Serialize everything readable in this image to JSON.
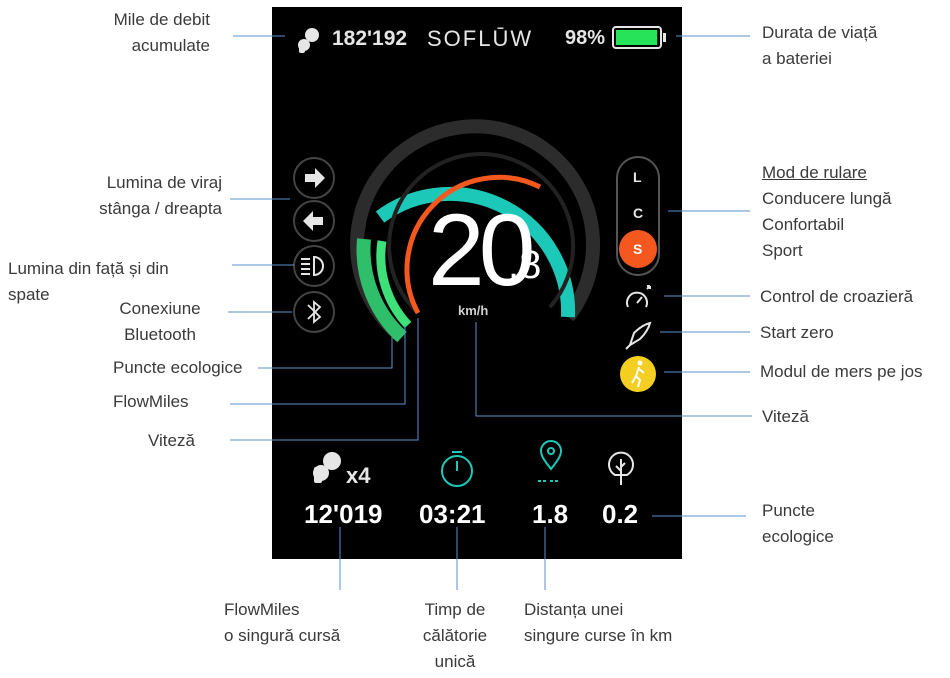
{
  "callouts": {
    "flowmiles_total": [
      "Mile de debit",
      "acumulate"
    ],
    "battery_life": [
      "Durata de viață",
      "a bateriei"
    ],
    "turn_signal": [
      "Lumina de viraj",
      "stânga / dreapta"
    ],
    "lights": [
      "Lumina din față și din",
      "spate"
    ],
    "bluetooth": [
      "Conexiune",
      "Bluetooth"
    ],
    "eco_points_arc": "Puncte ecologice",
    "flowmiles_arc": "FlowMiles",
    "speed_arc": "Viteză",
    "drive_mode_title": "Mod de rulare",
    "drive_modes": [
      "Conducere lungă",
      "Confortabil",
      "Sport"
    ],
    "cruise_control": "Control de croazieră",
    "zero_start": "Start zero",
    "walk_mode": "Modul de mers pe jos",
    "speed_value": "Viteză",
    "eco_points_trip": [
      "Puncte",
      "ecologice"
    ],
    "flowmiles_trip": [
      "FlowMiles",
      "o singură cursă"
    ],
    "trip_time": [
      "Timp de",
      "călătorie",
      "unică"
    ],
    "trip_distance": [
      "Distanța unei",
      "singure curse în km"
    ]
  },
  "display": {
    "total_miles": "182'192",
    "brand": "SOFLŪW",
    "battery_percent": "98%",
    "battery_level": 0.98,
    "speed_int": "20",
    "speed_dec": ".8",
    "speed_unit": "km/h",
    "modes": [
      "L",
      "C",
      "S"
    ],
    "active_mode": "S",
    "multiplier": "x4",
    "trip_flowmiles": "12'019",
    "trip_time": "03:21",
    "trip_distance": "1.8",
    "trip_eco": "0.2"
  },
  "colors": {
    "accent_orange": "#f4581f",
    "teal": "#1cc9b8",
    "green": "#3ee07a",
    "battery_green": "#27e35a",
    "walk_yellow": "#f4cf22"
  }
}
